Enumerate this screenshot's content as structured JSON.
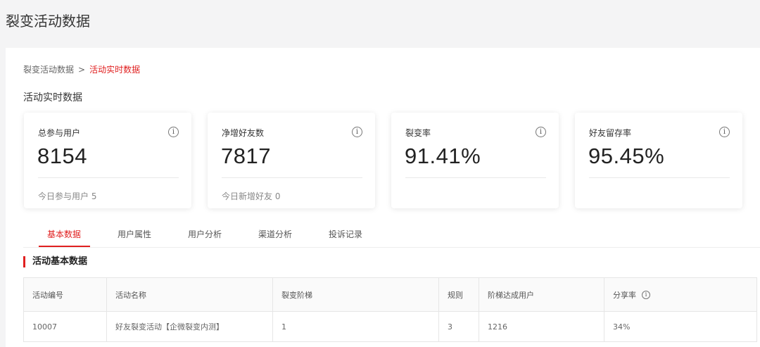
{
  "page_title": "裂变活动数据",
  "breadcrumb": {
    "parent": "裂变活动数据",
    "separator": ">",
    "current": "活动实时数据"
  },
  "section_title": "活动实时数据",
  "cards": [
    {
      "label": "总参与用户",
      "value": "8154",
      "sub": "今日参与用户 5"
    },
    {
      "label": "净增好友数",
      "value": "7817",
      "sub": "今日新增好友 0"
    },
    {
      "label": "裂变率",
      "value": "91.41%",
      "sub": ""
    },
    {
      "label": "好友留存率",
      "value": "95.45%",
      "sub": ""
    }
  ],
  "tabs": [
    {
      "label": "基本数据",
      "active": true
    },
    {
      "label": "用户属性",
      "active": false
    },
    {
      "label": "用户分析",
      "active": false
    },
    {
      "label": "渠道分析",
      "active": false
    },
    {
      "label": "投诉记录",
      "active": false
    }
  ],
  "table_title": "活动基本数据",
  "table": {
    "columns": [
      "活动编号",
      "活动名称",
      "裂变阶梯",
      "规则",
      "阶梯达成用户",
      "分享率"
    ],
    "rows": [
      [
        "10007",
        "好友裂变活动【企微裂变内测】",
        "1",
        "3",
        "1216",
        "34%"
      ]
    ]
  },
  "icons": {
    "info": "info-icon",
    "info_glyph": "i"
  },
  "colors": {
    "accent": "#e02020"
  }
}
